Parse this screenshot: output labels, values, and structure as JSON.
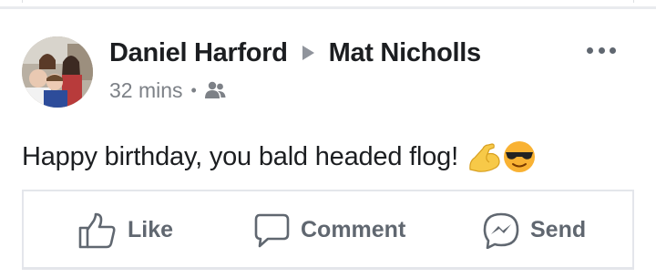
{
  "post": {
    "author": "Daniel Harford",
    "recipient": "Mat Nicholls",
    "timestamp": "32 mins",
    "separator": "•",
    "audience_icon": "friends-icon",
    "text": "Happy birthday, you bald headed flog!",
    "emojis": [
      "flexed-biceps-emoji",
      "sunglasses-face-emoji"
    ]
  },
  "actions": {
    "like": "Like",
    "comment": "Comment",
    "send": "Send"
  },
  "icons": {
    "more": "more-options-icon",
    "like": "thumbs-up-icon",
    "comment": "speech-bubble-icon",
    "send": "messenger-icon"
  },
  "colors": {
    "text_primary": "#1c1e21",
    "text_secondary": "#606770",
    "meta_gray": "#7d8187",
    "divider": "#e4e6eb"
  }
}
